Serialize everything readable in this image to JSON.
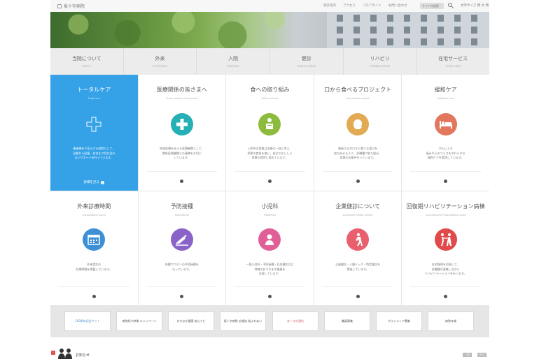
{
  "header": {
    "logo_text": "坂十字病院",
    "utility_links": [
      "受診案内",
      "アクセス",
      "フロアガイド",
      "お問い合わせ"
    ],
    "search_placeholder": "サイト内検索",
    "font_size_label": "文字サイズ 標 大 特"
  },
  "nav": [
    {
      "ja": "当院について",
      "en": "ABOUT"
    },
    {
      "ja": "外来",
      "en": "OUTPATIENT"
    },
    {
      "ja": "入院",
      "en": "INPATIENT"
    },
    {
      "ja": "健診",
      "en": "HEALTH CHECK"
    },
    {
      "ja": "リハビリ",
      "en": "REHABILITATION"
    },
    {
      "ja": "在宅サービス",
      "en": "HOME CARE"
    }
  ],
  "cards": [
    {
      "title": "トータルケア",
      "sub": "Total care",
      "desc": "患者様を下支えする病院として、\n治療から回復、在宅まで切れ目の\nないサポートを行っています。",
      "more": "詳細を見る",
      "color": "#ffffff",
      "icon": "cross-plus-icon"
    },
    {
      "title": "医療関係の皆さまへ",
      "sub": "To all medical chiropractic",
      "desc": "地域医療を支える医療機関として、\n関係医療機関との連携を大切に\nしています。",
      "color": "#25b0b5",
      "icon": "medical-cross-icon"
    },
    {
      "title": "食への取り組み",
      "sub": "Effort of food",
      "desc": "入院中の食事は治療の一部と考え、\n季節の食材を使い、安全でおいしい\n食事の提供に努めています。",
      "color": "#8dbb3d",
      "icon": "person-eating-icon"
    },
    {
      "title": "口から食べるプロジェクト",
      "sub": "Oral intake project",
      "desc": "患者さまが口から食べる喜びを\n取り戻せるよう、多職種で取り組み、\n食事の支援を行っています。",
      "color": "#e2aa52",
      "icon": "face-profile-icon"
    },
    {
      "title": "緩和ケア",
      "sub": "Palliative care",
      "desc": "がんによる\n痛みや心のつらさをやわらげる\n緩和ケアを実践しています。",
      "color": "#e2775d",
      "icon": "hospital-bed-icon"
    },
    {
      "title": "外来診療時間",
      "sub": "Consultation hours",
      "desc": "外来受診の\n診療時間を掲載しています。",
      "color": "#3d8fd6",
      "icon": "calendar-icon"
    },
    {
      "title": "予防接種",
      "sub": "Vaccination",
      "desc": "各種ワクチンの予防接種を\n行っています。",
      "color": "#8a63c9",
      "icon": "syringe-icon"
    },
    {
      "title": "小児科",
      "sub": "Pediatrics",
      "desc": "一般小児科・予防接種・乳児健診など\n地域のお子さまの健康を\n支援しています。",
      "color": "#e05f96",
      "icon": "child-icon"
    },
    {
      "title": "企業健診について",
      "sub": "Corporate health checks",
      "desc": "企業健診・人間ドック・特定健診を\n実施しています。",
      "color": "#e95f6e",
      "icon": "walking-person-icon"
    },
    {
      "title": "回復期リハビリテーション病棟",
      "sub": "Convalescent rehabilitation ward",
      "desc": "在宅復帰を目指して、\n多職種が連携しながら\nリハビリテーションを行います。",
      "color": "#e04a4a",
      "icon": "walking-assist-icon"
    }
  ],
  "banners": [
    "100周年記念サイト",
    "病院紹介映像 キャンペーン",
    "まちなか健康 安心ナビ",
    "坂十字病院 広報誌 桜ふれあい",
    "あーきれ通信",
    "職員募集",
    "ボランティア募集",
    "病院年報"
  ],
  "bottom": {
    "news_title": "お知らせ",
    "pager": [
      "一覧",
      "RSS"
    ]
  }
}
